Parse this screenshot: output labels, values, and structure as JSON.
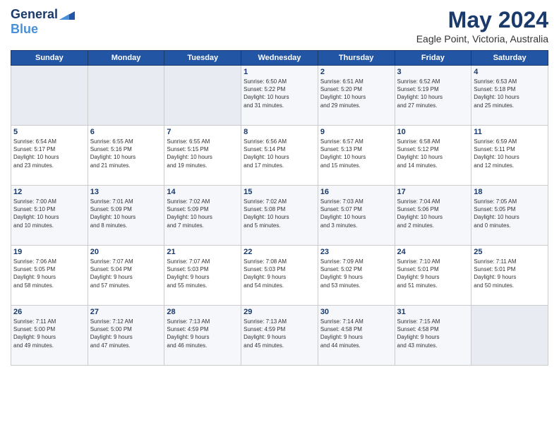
{
  "app": {
    "logo_general": "General",
    "logo_blue": "Blue",
    "title": "May 2024",
    "subtitle": "Eagle Point, Victoria, Australia"
  },
  "calendar": {
    "headers": [
      "Sunday",
      "Monday",
      "Tuesday",
      "Wednesday",
      "Thursday",
      "Friday",
      "Saturday"
    ],
    "weeks": [
      [
        {
          "day": "",
          "info": ""
        },
        {
          "day": "",
          "info": ""
        },
        {
          "day": "",
          "info": ""
        },
        {
          "day": "1",
          "info": "Sunrise: 6:50 AM\nSunset: 5:22 PM\nDaylight: 10 hours\nand 31 minutes."
        },
        {
          "day": "2",
          "info": "Sunrise: 6:51 AM\nSunset: 5:20 PM\nDaylight: 10 hours\nand 29 minutes."
        },
        {
          "day": "3",
          "info": "Sunrise: 6:52 AM\nSunset: 5:19 PM\nDaylight: 10 hours\nand 27 minutes."
        },
        {
          "day": "4",
          "info": "Sunrise: 6:53 AM\nSunset: 5:18 PM\nDaylight: 10 hours\nand 25 minutes."
        }
      ],
      [
        {
          "day": "5",
          "info": "Sunrise: 6:54 AM\nSunset: 5:17 PM\nDaylight: 10 hours\nand 23 minutes."
        },
        {
          "day": "6",
          "info": "Sunrise: 6:55 AM\nSunset: 5:16 PM\nDaylight: 10 hours\nand 21 minutes."
        },
        {
          "day": "7",
          "info": "Sunrise: 6:55 AM\nSunset: 5:15 PM\nDaylight: 10 hours\nand 19 minutes."
        },
        {
          "day": "8",
          "info": "Sunrise: 6:56 AM\nSunset: 5:14 PM\nDaylight: 10 hours\nand 17 minutes."
        },
        {
          "day": "9",
          "info": "Sunrise: 6:57 AM\nSunset: 5:13 PM\nDaylight: 10 hours\nand 15 minutes."
        },
        {
          "day": "10",
          "info": "Sunrise: 6:58 AM\nSunset: 5:12 PM\nDaylight: 10 hours\nand 14 minutes."
        },
        {
          "day": "11",
          "info": "Sunrise: 6:59 AM\nSunset: 5:11 PM\nDaylight: 10 hours\nand 12 minutes."
        }
      ],
      [
        {
          "day": "12",
          "info": "Sunrise: 7:00 AM\nSunset: 5:10 PM\nDaylight: 10 hours\nand 10 minutes."
        },
        {
          "day": "13",
          "info": "Sunrise: 7:01 AM\nSunset: 5:09 PM\nDaylight: 10 hours\nand 8 minutes."
        },
        {
          "day": "14",
          "info": "Sunrise: 7:02 AM\nSunset: 5:09 PM\nDaylight: 10 hours\nand 7 minutes."
        },
        {
          "day": "15",
          "info": "Sunrise: 7:02 AM\nSunset: 5:08 PM\nDaylight: 10 hours\nand 5 minutes."
        },
        {
          "day": "16",
          "info": "Sunrise: 7:03 AM\nSunset: 5:07 PM\nDaylight: 10 hours\nand 3 minutes."
        },
        {
          "day": "17",
          "info": "Sunrise: 7:04 AM\nSunset: 5:06 PM\nDaylight: 10 hours\nand 2 minutes."
        },
        {
          "day": "18",
          "info": "Sunrise: 7:05 AM\nSunset: 5:05 PM\nDaylight: 10 hours\nand 0 minutes."
        }
      ],
      [
        {
          "day": "19",
          "info": "Sunrise: 7:06 AM\nSunset: 5:05 PM\nDaylight: 9 hours\nand 58 minutes."
        },
        {
          "day": "20",
          "info": "Sunrise: 7:07 AM\nSunset: 5:04 PM\nDaylight: 9 hours\nand 57 minutes."
        },
        {
          "day": "21",
          "info": "Sunrise: 7:07 AM\nSunset: 5:03 PM\nDaylight: 9 hours\nand 55 minutes."
        },
        {
          "day": "22",
          "info": "Sunrise: 7:08 AM\nSunset: 5:03 PM\nDaylight: 9 hours\nand 54 minutes."
        },
        {
          "day": "23",
          "info": "Sunrise: 7:09 AM\nSunset: 5:02 PM\nDaylight: 9 hours\nand 53 minutes."
        },
        {
          "day": "24",
          "info": "Sunrise: 7:10 AM\nSunset: 5:01 PM\nDaylight: 9 hours\nand 51 minutes."
        },
        {
          "day": "25",
          "info": "Sunrise: 7:11 AM\nSunset: 5:01 PM\nDaylight: 9 hours\nand 50 minutes."
        }
      ],
      [
        {
          "day": "26",
          "info": "Sunrise: 7:11 AM\nSunset: 5:00 PM\nDaylight: 9 hours\nand 49 minutes."
        },
        {
          "day": "27",
          "info": "Sunrise: 7:12 AM\nSunset: 5:00 PM\nDaylight: 9 hours\nand 47 minutes."
        },
        {
          "day": "28",
          "info": "Sunrise: 7:13 AM\nSunset: 4:59 PM\nDaylight: 9 hours\nand 46 minutes."
        },
        {
          "day": "29",
          "info": "Sunrise: 7:13 AM\nSunset: 4:59 PM\nDaylight: 9 hours\nand 45 minutes."
        },
        {
          "day": "30",
          "info": "Sunrise: 7:14 AM\nSunset: 4:58 PM\nDaylight: 9 hours\nand 44 minutes."
        },
        {
          "day": "31",
          "info": "Sunrise: 7:15 AM\nSunset: 4:58 PM\nDaylight: 9 hours\nand 43 minutes."
        },
        {
          "day": "",
          "info": ""
        }
      ]
    ]
  }
}
